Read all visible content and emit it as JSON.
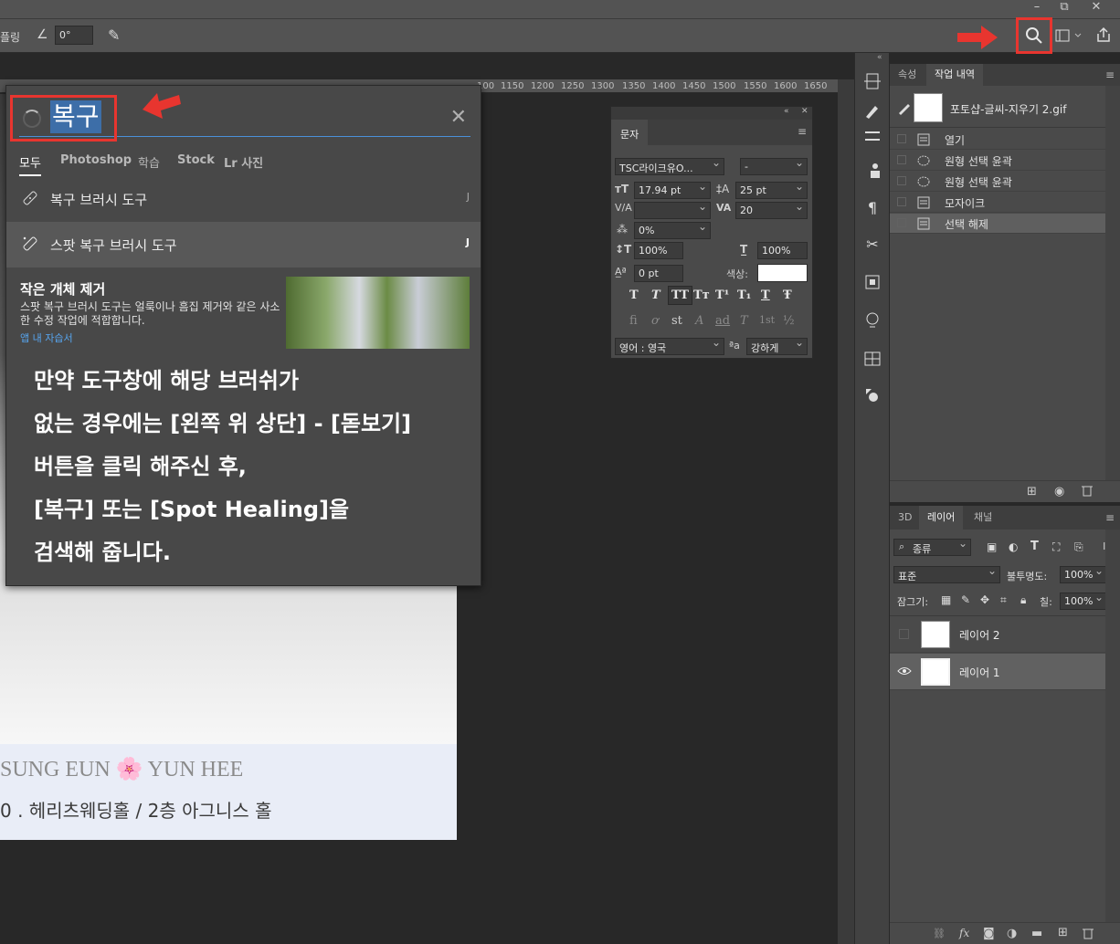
{
  "options_bar": {
    "prefix_label": "플링",
    "angle_value": "0°"
  },
  "ruler_labels": [
    "100",
    "1150",
    "1200",
    "1250",
    "1300",
    "1350",
    "1400",
    "1450",
    "1500",
    "1550",
    "1600",
    "1650"
  ],
  "document": {
    "names": "SUNG EUN 🌸 YUN HEE",
    "venue": "0 . 헤리츠웨딩홀 / 2층 아그니스 홀"
  },
  "search_dialog": {
    "query": "복구",
    "tabs": [
      "모두",
      "Photoshop",
      "학습",
      "Stock",
      "Lr 사진"
    ],
    "results": [
      {
        "label": "복구 브러시 도구",
        "shortcut": "J"
      },
      {
        "label": "스팟 복구 브러시 도구",
        "shortcut": "J"
      }
    ],
    "tip": {
      "title": "작은 개체 제거",
      "description": "스팟 복구 브러시 도구는 얼룩이나 흠집 제거와 같은 사소한 수정 작업에 적합합니다.",
      "link": "앱 내 자습서"
    },
    "annotation": "만약 도구창에 해당 브러쉬가\n없는 경우에는 [왼쪽 위 상단] - [돋보기]\n버튼을 클릭 해주신 후,\n[복구] 또는 [Spot Healing]을\n검색해 줍니다."
  },
  "character_panel": {
    "title": "문자",
    "font_family": "TSC라이크유O...",
    "font_style": "-",
    "font_size": "17.94 pt",
    "leading": "25 pt",
    "kerning": "",
    "tracking": "20",
    "tsume": "0%",
    "vertical_scale": "100%",
    "horizontal_scale": "100%",
    "baseline_shift": "0 pt",
    "color_label": "색상:",
    "language": "영어 : 영국",
    "antialias": "강하게",
    "aa_label": "ªa",
    "style_buttons": [
      "T",
      "T",
      "TT",
      "Tт",
      "T¹",
      "T₁",
      "T",
      "Ŧ"
    ],
    "opentype_buttons": [
      "fi",
      "ơ",
      "st",
      "A",
      "ad",
      "T",
      "1st",
      "½"
    ]
  },
  "history_panel": {
    "tabs": [
      "속성",
      "작업 내역"
    ],
    "snapshot": "포토샵-글씨-지우기 2.gif",
    "items": [
      "열기",
      "원형 선택 윤곽",
      "원형 선택 윤곽",
      "모자이크",
      "선택 해제"
    ]
  },
  "layers_panel": {
    "tabs": [
      "3D",
      "레이어",
      "채널"
    ],
    "filter": "종류",
    "blend_mode": "표준",
    "opacity_label": "불투명도:",
    "opacity_value": "100%",
    "lock_label": "잠그기:",
    "fill_label": "칠:",
    "fill_value": "100%",
    "layers": [
      "레이어 2",
      "레이어 1"
    ]
  },
  "colors": {
    "accent_red": "#e8352f",
    "selection_blue": "#3d6ea8",
    "link_blue": "#57a5ef"
  }
}
